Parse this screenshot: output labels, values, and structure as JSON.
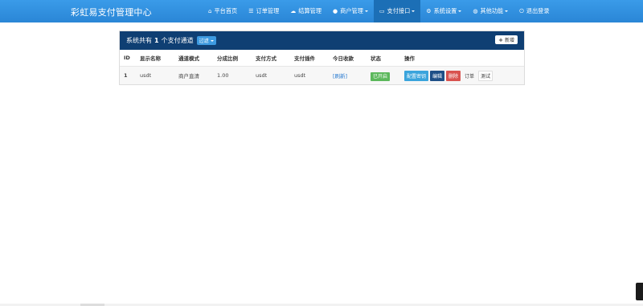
{
  "brand": "彩虹易支付管理中心",
  "nav": [
    {
      "label": "平台首页",
      "icon": "home-icon",
      "glyph": "⌂",
      "dropdown": false,
      "active": false
    },
    {
      "label": "订单管理",
      "icon": "list-icon",
      "glyph": "☰",
      "dropdown": false,
      "active": false
    },
    {
      "label": "结算管理",
      "icon": "cloud-icon",
      "glyph": "☁",
      "dropdown": false,
      "active": false
    },
    {
      "label": "商户管理",
      "icon": "user-icon",
      "glyph": "👤",
      "dropdown": true,
      "active": false
    },
    {
      "label": "支付接口",
      "icon": "credit-card-icon",
      "glyph": "▭",
      "dropdown": true,
      "active": true
    },
    {
      "label": "系统设置",
      "icon": "gear-icon",
      "glyph": "⚙",
      "dropdown": true,
      "active": false
    },
    {
      "label": "其他功能",
      "icon": "globe-icon",
      "glyph": "◍",
      "dropdown": true,
      "active": false
    },
    {
      "label": "退出登录",
      "icon": "power-icon",
      "glyph": "⏻",
      "dropdown": false,
      "active": false
    }
  ],
  "panel": {
    "title_prefix": "系统共有",
    "count": "1",
    "title_suffix": "个支付通道",
    "filter_label": "过滤",
    "add_label": "新增"
  },
  "table": {
    "headers": [
      "ID",
      "显示名称",
      "通道模式",
      "分成比例",
      "支付方式",
      "支付插件",
      "今日收款",
      "状态",
      "操作"
    ],
    "rows": [
      {
        "id": "1",
        "name": "usdt",
        "mode": "商户直清",
        "rate": "1.00",
        "type": "usdt",
        "plugin": "usdt",
        "today": "[刷新]",
        "status": "已开启",
        "actions": [
          "配置密钥",
          "编辑",
          "删除",
          "订单",
          "测试"
        ]
      }
    ]
  },
  "colors": {
    "navbar": "#2a86d6",
    "panel_header": "#0f3f73",
    "status_on": "#5cb85c",
    "danger": "#d9534f"
  }
}
